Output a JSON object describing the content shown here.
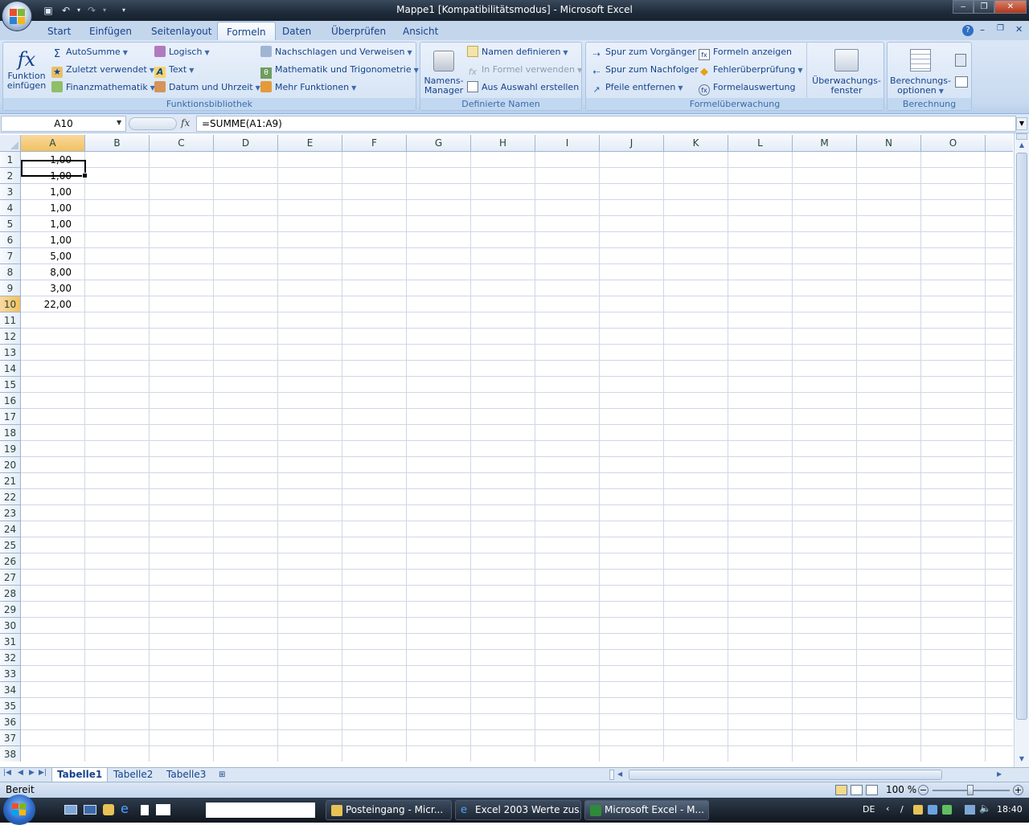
{
  "window": {
    "title": "Mappe1  [Kompatibilitätsmodus] - Microsoft Excel",
    "controls": [
      "‒",
      "❐",
      "✕"
    ]
  },
  "ribbon_tabs": [
    "Start",
    "Einfügen",
    "Seitenlayout",
    "Formeln",
    "Daten",
    "Überprüfen",
    "Ansicht"
  ],
  "active_tab": "Formeln",
  "groups": {
    "funktionsbibliothek": {
      "label": "Funktionsbibliothek",
      "insert_function": [
        "Funktion",
        "einfügen"
      ],
      "autosum": "AutoSumme",
      "recent": "Zuletzt verwendet",
      "financial": "Finanzmathematik",
      "logical": "Logisch",
      "text": "Text",
      "datetime": "Datum und Uhrzeit",
      "lookup": "Nachschlagen und Verweisen",
      "math": "Mathematik und Trigonometrie",
      "more": "Mehr Funktionen"
    },
    "definierte_namen": {
      "label": "Definierte Namen",
      "manager": [
        "Namens-",
        "Manager"
      ],
      "define": "Namen definieren",
      "use_in_formula": "In Formel verwenden",
      "create": "Aus Auswahl erstellen"
    },
    "formelueberwachung": {
      "label": "Formelüberwachung",
      "precedents": "Spur zum Vorgänger",
      "dependents": "Spur zum Nachfolger",
      "remove_arrows": "Pfeile entfernen",
      "show_formulas": "Formeln anzeigen",
      "error_check": "Fehlerüberprüfung",
      "evaluate": "Formelauswertung",
      "watch": [
        "Überwachungs-",
        "fenster"
      ]
    },
    "berechnung": {
      "label": "Berechnung",
      "options": [
        "Berechnungs-",
        "optionen"
      ]
    }
  },
  "formula_bar": {
    "name_box": "A10",
    "fx": "fx",
    "formula": "=SUMME(A1:A9)"
  },
  "columns": [
    "A",
    "B",
    "C",
    "D",
    "E",
    "F",
    "G",
    "H",
    "I",
    "J",
    "K",
    "L",
    "M",
    "N",
    "O"
  ],
  "rows": [
    "1",
    "2",
    "3",
    "4",
    "5",
    "6",
    "7",
    "8",
    "9",
    "10",
    "11",
    "12",
    "13",
    "14",
    "15",
    "16",
    "17",
    "18",
    "19",
    "20",
    "21",
    "22",
    "23",
    "24",
    "25",
    "26",
    "27",
    "28",
    "29",
    "30",
    "31",
    "32",
    "33",
    "34",
    "35",
    "36",
    "37",
    "38"
  ],
  "cells_A": [
    "1,00",
    "1,00",
    "1,00",
    "1,00",
    "1,00",
    "1,00",
    "5,00",
    "8,00",
    "3,00",
    "22,00"
  ],
  "selected_cell": "A10",
  "sheets": [
    "Tabelle1",
    "Tabelle2",
    "Tabelle3"
  ],
  "active_sheet": "Tabelle1",
  "status": {
    "ready": "Bereit",
    "zoom": "100 %"
  },
  "taskbar": {
    "tasks": [
      "Posteingang - Micr...",
      "Excel 2003 Werte zus...",
      "Microsoft Excel - M..."
    ],
    "lang": "DE",
    "clock": "18:40"
  }
}
